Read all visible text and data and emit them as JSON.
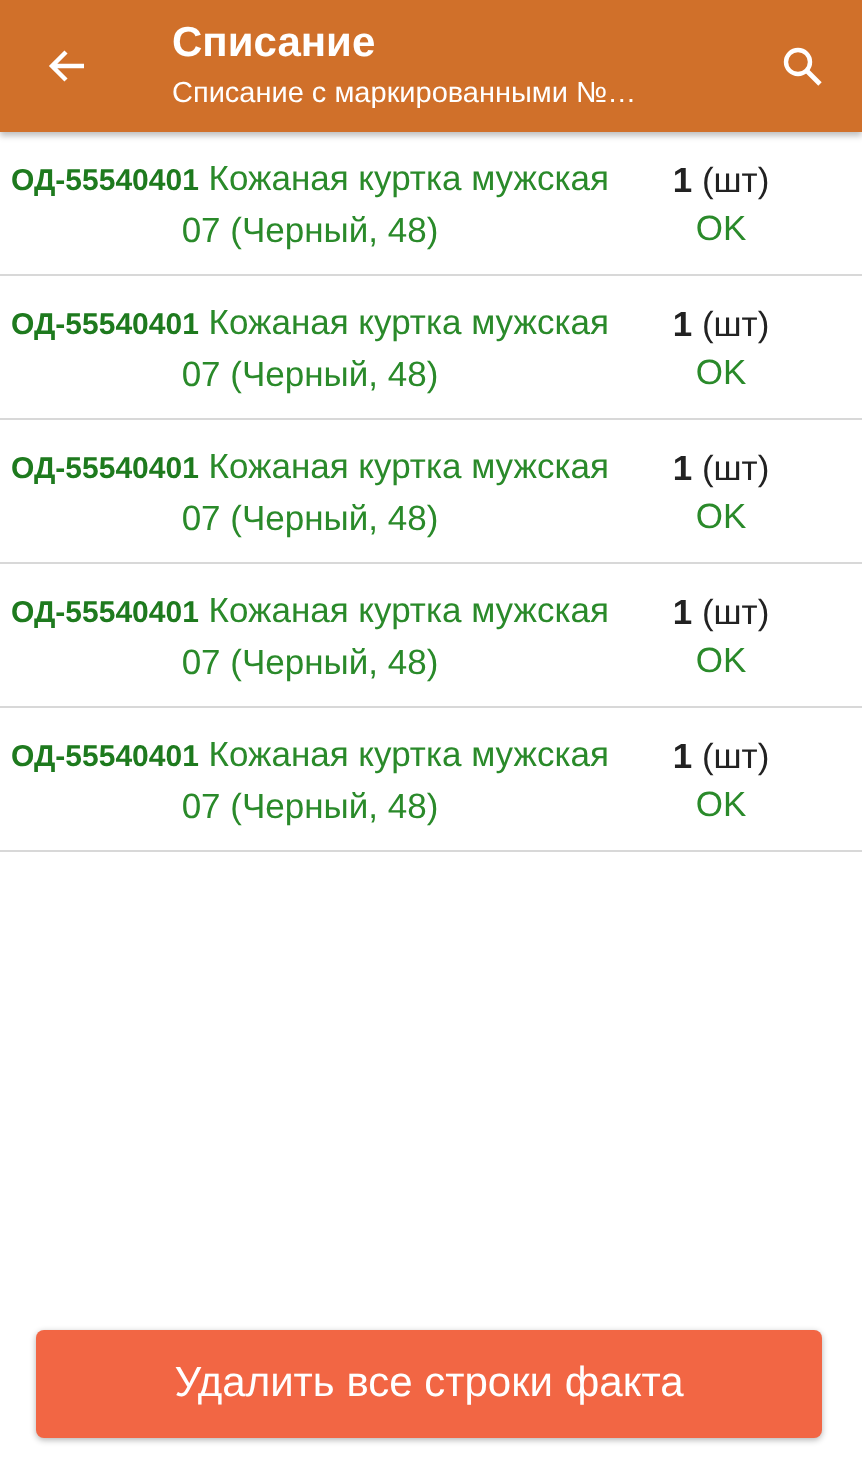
{
  "app_bar": {
    "title": "Списание",
    "subtitle": "Списание с маркированными №…"
  },
  "items": [
    {
      "description": "**ОД-55540401** Кожаная куртка мужская 07 (Черный, 48)",
      "quantity": "**1** (шт)",
      "status": "OK"
    },
    {
      "description": "**ОД-55540401** Кожаная куртка мужская 07 (Черный, 48)",
      "quantity": "**1** (шт)",
      "status": "OK"
    },
    {
      "description": "**ОД-55540401** Кожаная куртка мужская 07 (Черный, 48)",
      "quantity": "**1** (шт)",
      "status": "OK"
    },
    {
      "description": "**ОД-55540401** Кожаная куртка мужская 07 (Черный, 48)",
      "quantity": "**1** (шт)",
      "status": "OK"
    },
    {
      "description": "**ОД-55540401** Кожаная куртка мужская 07 (Черный, 48)",
      "quantity": "**1** (шт)",
      "status": "OK"
    }
  ],
  "action_button": "Удалить все строки факта"
}
